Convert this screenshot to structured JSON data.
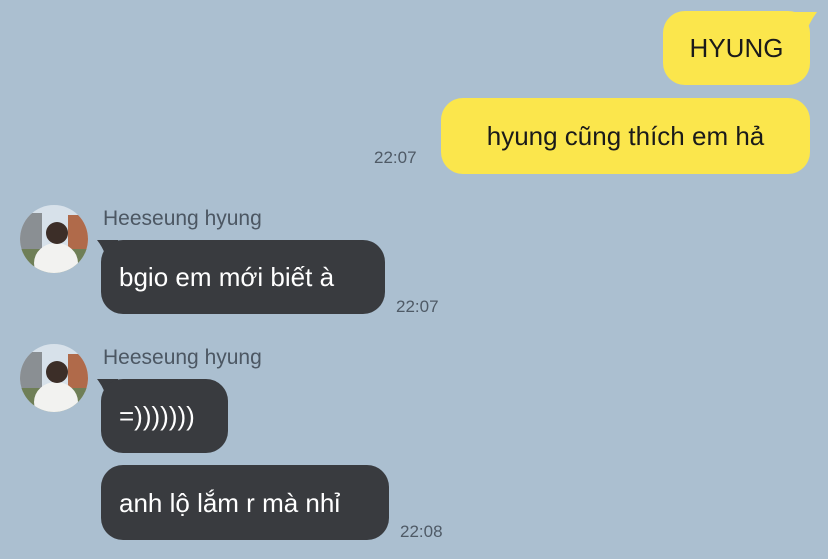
{
  "chat": {
    "messages": [
      {
        "direction": "outgoing",
        "text": "HYUNG"
      },
      {
        "direction": "outgoing",
        "text": "hyung cũng thích em hả",
        "time": "22:07"
      },
      {
        "direction": "incoming",
        "sender": "Heeseung hyung",
        "text": "bgio em mới biết à",
        "time": "22:07"
      },
      {
        "direction": "incoming",
        "sender": "Heeseung hyung",
        "text": "=)))))))"
      },
      {
        "direction": "incoming",
        "text": "anh lộ lắm r mà nhỉ",
        "time": "22:08"
      }
    ]
  },
  "colors": {
    "background": "#abbfd0",
    "outgoing_bubble": "#fbe64c",
    "incoming_bubble": "#393b3f"
  }
}
